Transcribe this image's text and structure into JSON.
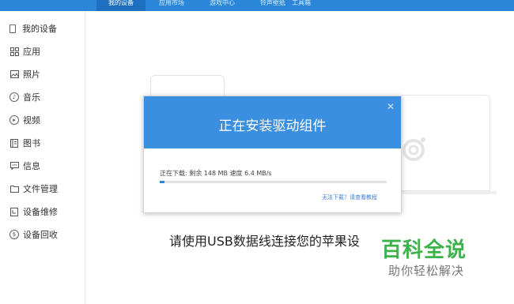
{
  "top_nav": {
    "tabs": [
      {
        "label": "我的设备",
        "active": true
      },
      {
        "label": "应用市场",
        "active": false
      },
      {
        "label": "游戏中心",
        "active": false
      },
      {
        "label": "铃声壁纸",
        "active": false
      },
      {
        "label": "工具箱",
        "active": false
      }
    ]
  },
  "sidebar": {
    "items": [
      {
        "label": "我的设备",
        "icon": "device-icon"
      },
      {
        "label": "应用",
        "icon": "apps-icon"
      },
      {
        "label": "照片",
        "icon": "photo-icon"
      },
      {
        "label": "音乐",
        "icon": "music-icon"
      },
      {
        "label": "视频",
        "icon": "video-icon"
      },
      {
        "label": "图书",
        "icon": "book-icon"
      },
      {
        "label": "信息",
        "icon": "message-icon"
      },
      {
        "label": "文件管理",
        "icon": "folder-icon"
      },
      {
        "label": "设备维修",
        "icon": "repair-icon"
      },
      {
        "label": "设备回收",
        "icon": "recycle-icon"
      }
    ]
  },
  "main": {
    "connect_prompt": "请使用USB数据线连接您的苹果设"
  },
  "dialog": {
    "title": "正在安装驱动组件",
    "progress_text": "正在下载: 剩余 148 MB 速度 6.4 MB/s",
    "progress_fraction": 0.02,
    "help_link": "无法下载？请查看教程"
  },
  "watermark": {
    "title": "百科全说",
    "subtitle": "助你轻松解决"
  },
  "colors": {
    "accent": "#2a86d8",
    "dialog_header": "#3a8fe0",
    "watermark_green": "#3cb34a"
  }
}
